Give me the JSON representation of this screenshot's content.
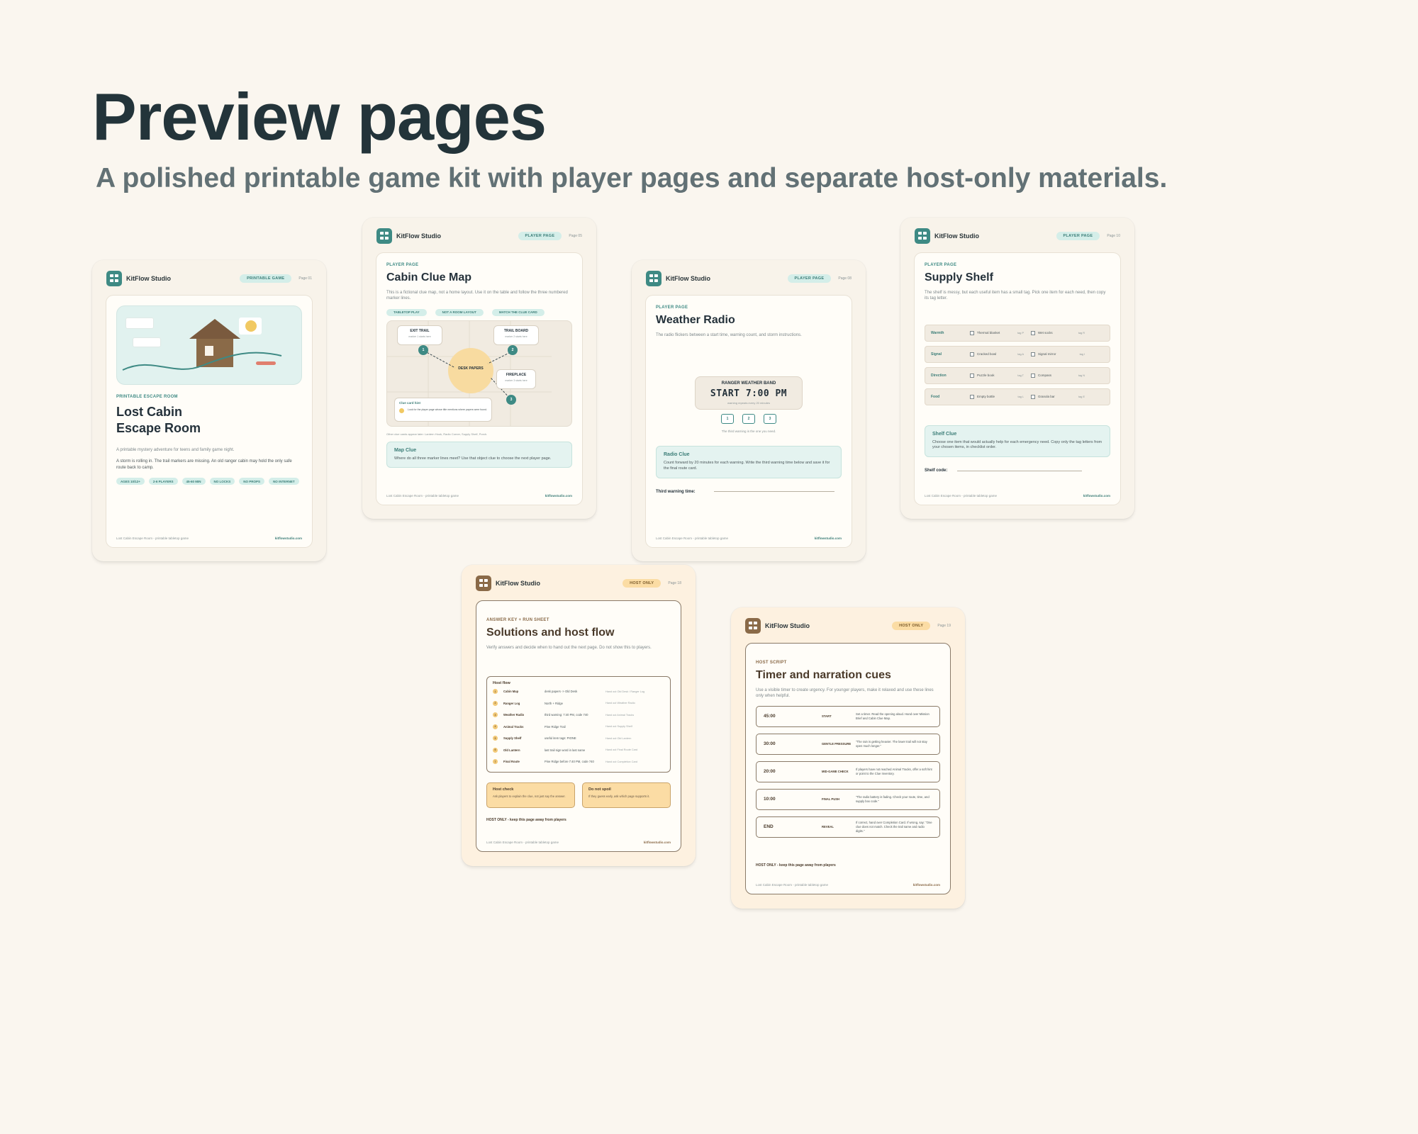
{
  "hero": {
    "title": "Preview pages",
    "subtitle": "A polished printable game kit with player pages and separate host-only materials."
  },
  "brand": "KitFlow Studio",
  "footer_left": "Lost Cabin Escape Room - printable tabletop game",
  "footer_right": "kitflowstudio.com",
  "host_only_line": "HOST ONLY - keep this page away from players",
  "cover": {
    "pill": "PRINTABLE GAME",
    "page": "Page 01",
    "kicker": "PRINTABLE ESCAPE ROOM",
    "title_line1": "Lost Cabin",
    "title_line2": "Escape Room",
    "desc": "A printable mystery adventure for teens and family game night.",
    "story": "A storm is rolling in. The trail markers are missing. An old ranger cabin may hold the only safe route back to camp.",
    "tags": [
      "AGES 10/12+",
      "2-6 PLAYERS",
      "45-60 MIN",
      "NO LOCKS",
      "NO PROPS",
      "NO INTERNET"
    ]
  },
  "clue_map": {
    "pill": "PLAYER PAGE",
    "page": "Page 05",
    "kicker": "PLAYER PAGE",
    "title": "Cabin Clue Map",
    "desc": "This is a fictional clue map, not a home layout. Use it on the table and follow the three numbered marker lines.",
    "chips": [
      "TABLETOP PLAY",
      "NOT A ROOM LAYOUT",
      "MATCH THE CLUE CARD"
    ],
    "nodes": {
      "exit_trail": "EXIT TRAIL",
      "exit_sub": "marker 1 starts here",
      "trail_board": "TRAIL BOARD",
      "trail_sub": "marker 2 starts here",
      "fireplace": "FIREPLACE",
      "fireplace_sub": "marker 3 starts here",
      "desk": "DESK PAPERS"
    },
    "markers": [
      "1",
      "2",
      "3"
    ],
    "hint_title": "Clue card hint",
    "hint_text": "Look for the player page whose title mentions where papers were found.",
    "other": "Other clue cards appear later: Lantern Hook, Radio Corner, Supply Shelf, Porch.",
    "callout_title": "Map Clue",
    "callout_text": "Where do all three marker lines meet? Use that object clue to choose the next player page."
  },
  "radio": {
    "pill": "PLAYER PAGE",
    "page": "Page 08",
    "kicker": "PLAYER PAGE",
    "title": "Weather Radio",
    "desc": "The radio flickers between a start time, warning count, and storm instructions.",
    "band_title": "RANGER WEATHER BAND",
    "display": "START  7:00 PM",
    "band_note": "warning repeats every 20 minutes",
    "buttons": [
      "1",
      "2",
      "3"
    ],
    "hint": "The third warning is the one you need.",
    "callout_title": "Radio Clue",
    "callout_text": "Count forward by 20 minutes for each warning. Write the third warning time below and save it for the final route card.",
    "answer_label": "Third warning time:"
  },
  "shelf": {
    "pill": "PLAYER PAGE",
    "page": "Page 10",
    "kicker": "PLAYER PAGE",
    "title": "Supply Shelf",
    "desc": "The shelf is messy, but each useful item has a small tag. Pick one item for each need, then copy its tag letter.",
    "rows": [
      {
        "cat": "Warmth",
        "a": "Thermal blanket",
        "at": "tag P",
        "b": "Wet socks",
        "bt": "tag R"
      },
      {
        "cat": "Signal",
        "a": "Cracked bowl",
        "at": "tag A",
        "b": "Signal mirror",
        "bt": "tag I"
      },
      {
        "cat": "Direction",
        "a": "Puzzle book",
        "at": "tag T",
        "b": "Compass",
        "bt": "tag N"
      },
      {
        "cat": "Food",
        "a": "Empty bottle",
        "at": "tag L",
        "b": "Granola bar",
        "bt": "tag E"
      }
    ],
    "callout_title": "Shelf Clue",
    "callout_text": "Choose one item that would actually help for each emergency need. Copy only the tag letters from your chosen items, in checklist order.",
    "answer_label": "Shelf code:"
  },
  "solutions": {
    "pill": "HOST ONLY",
    "page": "Page 18",
    "kicker": "ANSWER KEY + RUN SHEET",
    "title": "Solutions and host flow",
    "desc": "Verify answers and decide when to hand out the next page. Do not show this to players.",
    "flow_title": "Host flow",
    "flow": [
      {
        "n": "1",
        "a": "Cabin Map",
        "b": "desk papers -> Old Desk",
        "c": "Hand out Old Desk / Ranger Log"
      },
      {
        "n": "2",
        "a": "Ranger Log",
        "b": "North + Ridge",
        "c": "Hand out Weather Radio"
      },
      {
        "n": "3",
        "a": "Weather Radio",
        "b": "third warning: 7:40 PM, code 740",
        "c": "Hand out Animal Tracks"
      },
      {
        "n": "4",
        "a": "Animal Tracks",
        "b": "Pine Ridge Trail",
        "c": "Hand out Supply Shelf"
      },
      {
        "n": "5",
        "a": "Supply Shelf",
        "b": "useful item tags: PIONE",
        "c": "Hand out Old Lantern"
      },
      {
        "n": "6",
        "a": "Old Lantern",
        "b": "last trail sign word in last name",
        "c": "Hand out Final Route Card"
      },
      {
        "n": "7",
        "a": "Final Route",
        "b": "Pine Ridge before 7:40 PM, code 740",
        "c": "Hand out Completion Card"
      }
    ],
    "note1_title": "Host check",
    "note1_text": "Ask players to explain the clue, not just say the answer.",
    "note2_title": "Do not spoil",
    "note2_text": "If they guess early, ask which page supports it."
  },
  "timer": {
    "pill": "HOST ONLY",
    "page": "Page 19",
    "kicker": "HOST SCRIPT",
    "title": "Timer and narration cues",
    "desc": "Use a visible timer to create urgency. For younger players, make it relaxed and use these lines only when helpful.",
    "cues": [
      {
        "t": "45:00",
        "s": "START",
        "d": "Set a timer. Read the opening aloud. Hand over Mission Brief and Cabin Clue Map."
      },
      {
        "t": "30:00",
        "s": "GENTLE PRESSURE",
        "d": "\"The rain is getting heavier. The lower trail will not stay open much longer.\""
      },
      {
        "t": "20:00",
        "s": "MID-GAME CHECK",
        "d": "If players have not reached Animal Tracks, offer a soft hint or point to the Clue Inventory."
      },
      {
        "t": "10:00",
        "s": "FINAL PUSH",
        "d": "\"The radio battery is fading. Check your route, time, and supply box code.\""
      },
      {
        "t": "END",
        "s": "REVEAL",
        "d": "If correct, hand over Completion Card. If wrong, say: \"One clue does not match. Check the trail name and radio digits.\""
      }
    ]
  }
}
